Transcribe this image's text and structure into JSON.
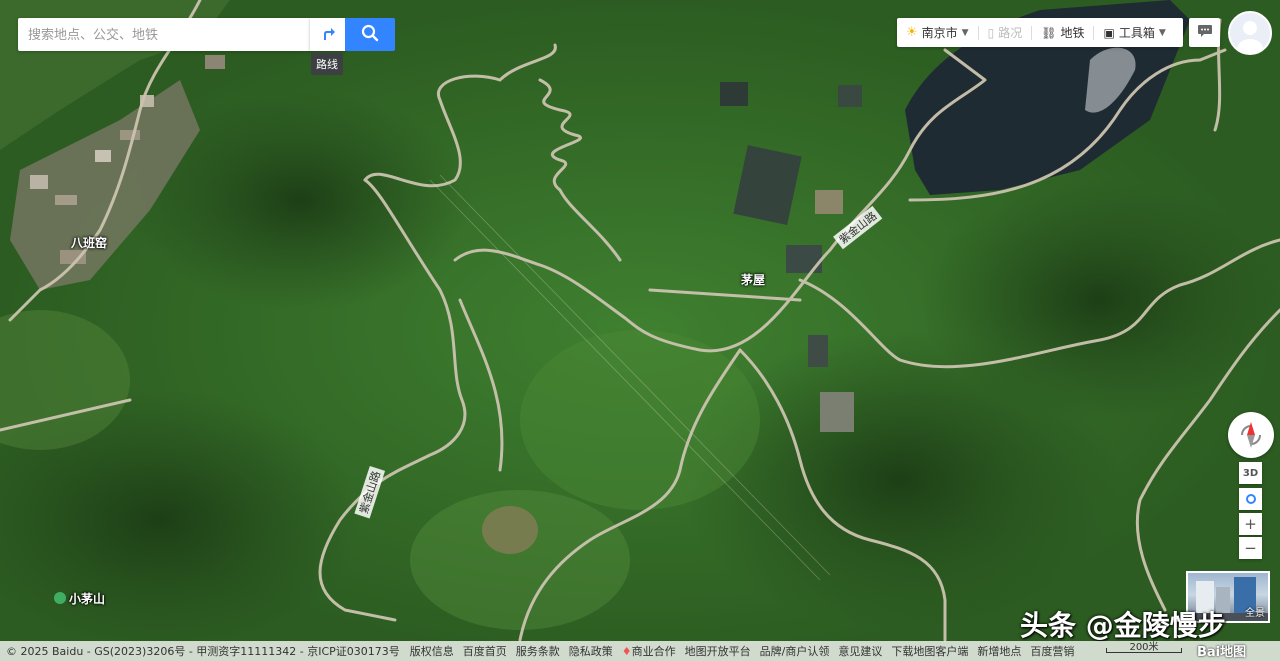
{
  "search": {
    "placeholder": "",
    "value": "搜索地点、公交、地铁"
  },
  "route_tooltip": "路线",
  "topbar": {
    "city": "南京市",
    "traffic": "路况",
    "subway": "地铁",
    "toolbox": "工具箱"
  },
  "places": {
    "babanyao": "八班窑",
    "maowu": "茅屋",
    "xiaomaoshan": "小茅山"
  },
  "roads": {
    "road_1": "紫金山路",
    "road_2": "紫金山路"
  },
  "controls": {
    "three_d": "3D",
    "zoom_in": "+",
    "zoom_out": "−",
    "street_view_label": "全景"
  },
  "footer": {
    "copyright": "© 2025 Baidu - GS(2023)3206号 - 甲测资字11111342 - 京ICP证030173号",
    "links": [
      "版权信息",
      "百度首页",
      "服务条款",
      "隐私政策",
      "商业合作",
      "地图开放平台",
      "品牌/商户认领",
      "意见建议",
      "下载地图客户端",
      "新增地点",
      "百度营销"
    ]
  },
  "scale": "200米",
  "logo": "Bai地图",
  "watermark": "头条 @金陵慢步",
  "colors": {
    "accent": "#3385ff",
    "forest": "#2f6a24",
    "road": "#c9c1ae"
  }
}
